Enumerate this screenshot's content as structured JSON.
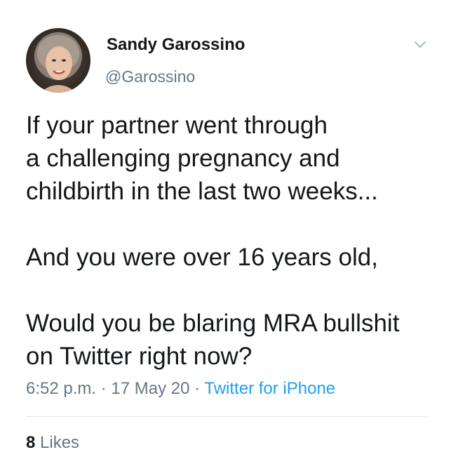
{
  "author": {
    "name": "Sandy Garossino",
    "handle": "@Garossino"
  },
  "tweet": {
    "text": "If your partner went through\na challenging pregnancy and\nchildbirth in the last two weeks...\n\nAnd you were over 16 years old,\n\nWould you be blaring MRA bullshit\non Twitter right now?",
    "time": "6:52 p.m.",
    "separator": "·",
    "date": "17 May 20",
    "source": "Twitter for iPhone"
  },
  "stats": {
    "likes_count": "8",
    "likes_label": "Likes"
  },
  "icons": {
    "menu": "chevron-down-icon"
  },
  "colors": {
    "text": "#14171a",
    "secondary": "#657786",
    "link": "#1da1f2",
    "divider": "#e1e8ed"
  }
}
